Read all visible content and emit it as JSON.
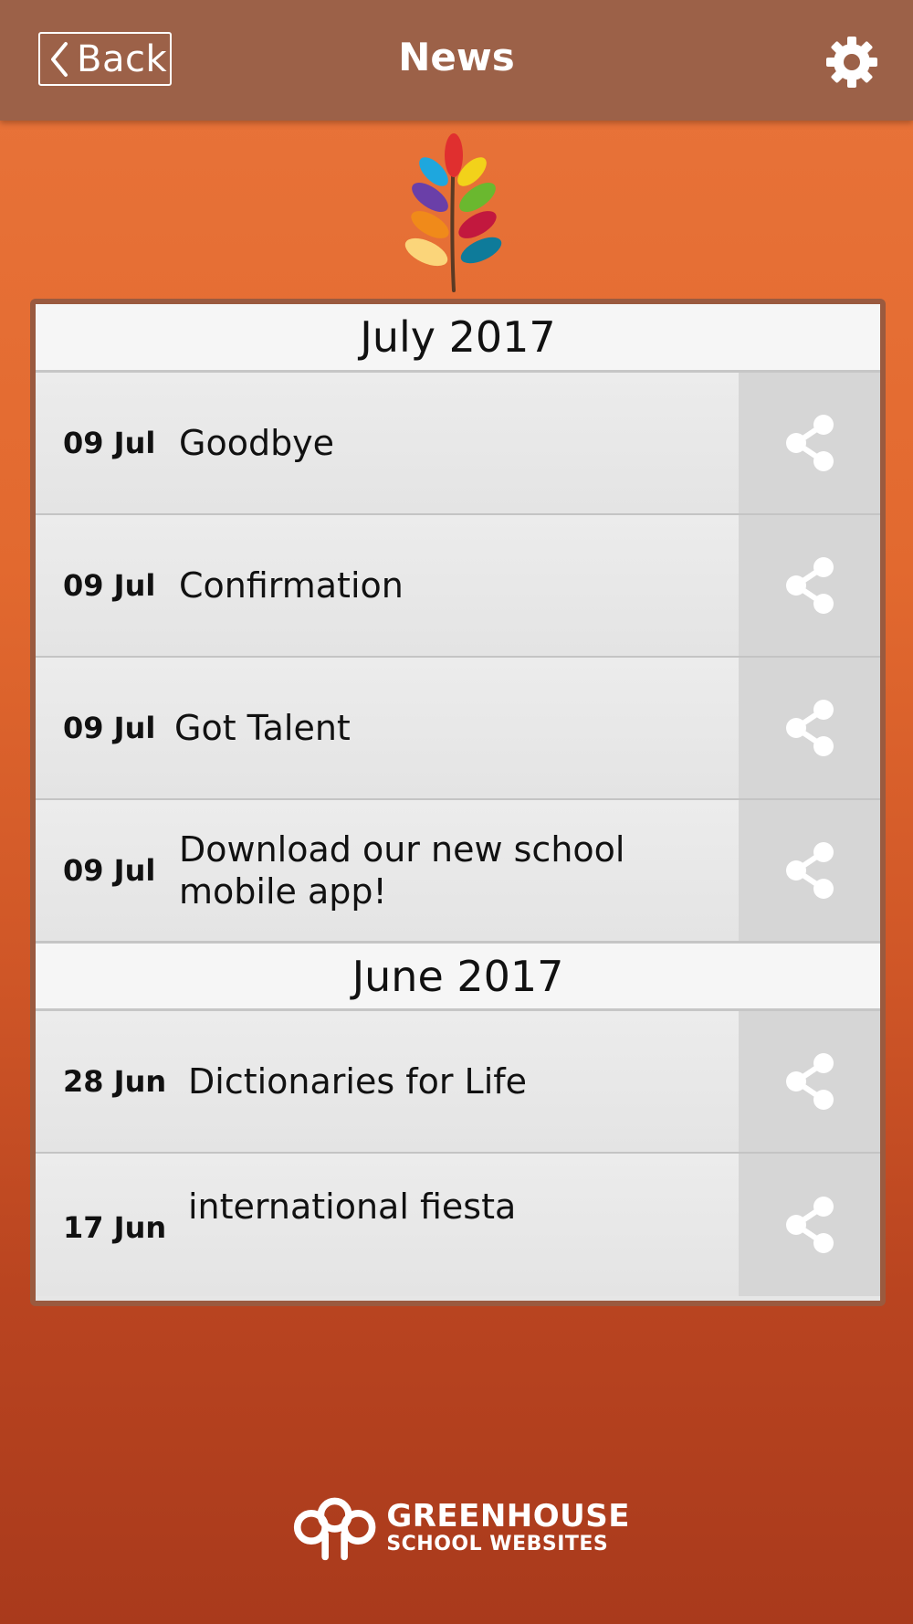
{
  "header": {
    "back_label": "Back",
    "title": "News"
  },
  "months": [
    {
      "label": "July 2017",
      "items": [
        {
          "date": "09 Jul",
          "title": "Goodbye"
        },
        {
          "date": "09 Jul",
          "title": "Confirmation"
        },
        {
          "date": "09 Jul",
          "title": "Got Talent"
        },
        {
          "date": "09 Jul",
          "title": "Download our new school mobile app!"
        }
      ]
    },
    {
      "label": "June 2017",
      "items": [
        {
          "date": "28 Jun",
          "title": "Dictionaries for Life"
        },
        {
          "date": "17 Jun",
          "title": "international fiesta"
        }
      ]
    }
  ],
  "footer": {
    "brand_line1": "GREENHOUSE",
    "brand_line2": "SCHOOL WEBSITES"
  },
  "icons": {
    "back": "chevron-left-icon",
    "settings": "gear-icon",
    "share": "share-icon",
    "logo": "leaf-logo-icon",
    "brand": "greenhouse-logo-icon"
  },
  "colors": {
    "header_bg": "#9c6148",
    "page_bg_top": "#e9743a",
    "page_bg_bottom": "#a93a1c",
    "panel_border": "#9a5a3f",
    "row_bg": "#e6e6e6",
    "share_bg": "#d6d6d6",
    "month_bg": "#f6f6f6"
  }
}
